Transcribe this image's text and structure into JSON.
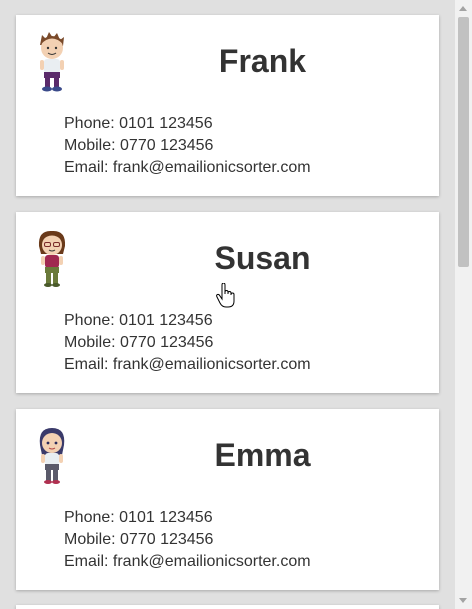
{
  "contacts": [
    {
      "name": "Frank",
      "phone": "Phone: 0101 123456",
      "mobile": "Mobile: 0770 123456",
      "email": "Email: frank@emailionicsorter.com",
      "avatar_icon": "boy-cartoon-avatar-icon"
    },
    {
      "name": "Susan",
      "phone": "Phone: 0101 123456",
      "mobile": "Mobile: 0770 123456",
      "email": "Email: frank@emailionicsorter.com",
      "avatar_icon": "girl-glasses-cartoon-avatar-icon"
    },
    {
      "name": "Emma",
      "phone": "Phone: 0101 123456",
      "mobile": "Mobile: 0770 123456",
      "email": "Email: frank@emailionicsorter.com",
      "avatar_icon": "girl-dark-hair-cartoon-avatar-icon"
    }
  ],
  "colors": {
    "background": "#e0e0e0",
    "card": "#ffffff",
    "text": "#333333"
  }
}
